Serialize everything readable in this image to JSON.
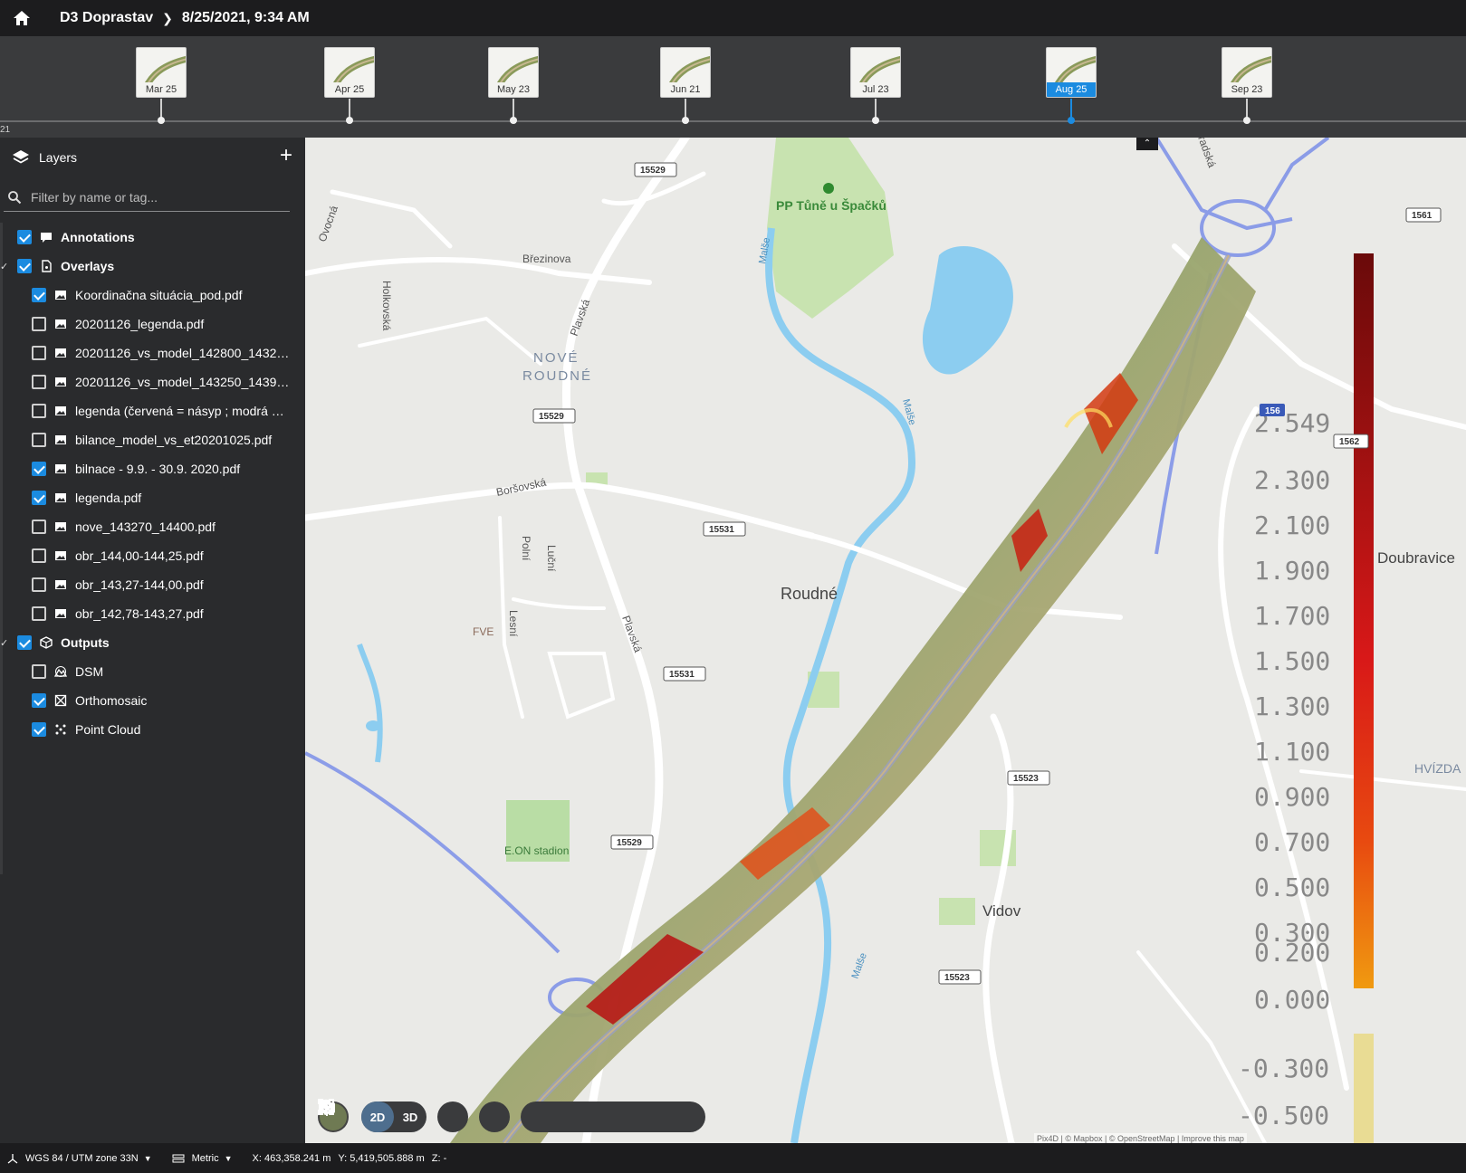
{
  "header": {
    "home_icon": "home-icon",
    "project": "D3 Doprastav",
    "date": "8/25/2021, 9:34 AM"
  },
  "timeline": {
    "year_label": "21",
    "items": [
      {
        "label": "Mar 25",
        "active": false
      },
      {
        "label": "Apr 25",
        "active": false
      },
      {
        "label": "May 23",
        "active": false
      },
      {
        "label": "Jun 21",
        "active": false
      },
      {
        "label": "Jul 23",
        "active": false
      },
      {
        "label": "Aug 25",
        "active": true
      },
      {
        "label": "Sep 23",
        "active": false
      }
    ]
  },
  "sidebar": {
    "title": "Layers",
    "add_icon": "plus-icon",
    "search_placeholder": "Filter by name or tag...",
    "annotations": {
      "label": "Annotations",
      "checked": true
    },
    "overlays": {
      "label": "Overlays",
      "checked": true,
      "items": [
        {
          "label": "Koordinačna situácia_pod.pdf",
          "checked": true
        },
        {
          "label": "20201126_legenda.pdf",
          "checked": false
        },
        {
          "label": "20201126_vs_model_142800_143200.pdf",
          "checked": false
        },
        {
          "label": "20201126_vs_model_143250_143950.pdf",
          "checked": false
        },
        {
          "label": "legenda (červená = násyp ; modrá = výkop).pdf",
          "checked": false
        },
        {
          "label": "bilance_model_vs_et20201025.pdf",
          "checked": false
        },
        {
          "label": "bilnace - 9.9. - 30.9. 2020.pdf",
          "checked": true
        },
        {
          "label": "legenda.pdf",
          "checked": true
        },
        {
          "label": "nove_143270_14400.pdf",
          "checked": false
        },
        {
          "label": "obr_144,00-144,25.pdf",
          "checked": false
        },
        {
          "label": "obr_143,27-144,00.pdf",
          "checked": false
        },
        {
          "label": "obr_142,78-143,27.pdf",
          "checked": false
        }
      ]
    },
    "outputs": {
      "label": "Outputs",
      "checked": true,
      "items": [
        {
          "label": "DSM",
          "checked": false,
          "icon": "dsm-icon"
        },
        {
          "label": "Orthomosaic",
          "checked": true,
          "icon": "orthomosaic-icon"
        },
        {
          "label": "Point Cloud",
          "checked": true,
          "icon": "point-cloud-icon"
        }
      ]
    }
  },
  "map": {
    "labels": {
      "pp_tune": "PP Tůně u Špačků",
      "nove_roudne_1": "NOVÉ",
      "nove_roudne_2": "ROUDNÉ",
      "roudne": "Roudné",
      "vidov": "Vidov",
      "doubravice": "Doubravice",
      "hvizda": "HVÍZDA",
      "eon": "E.ON stadion",
      "fve": "FVE",
      "brezinova": "Březinova",
      "plavska": "Plavská",
      "borsovska": "Boršovská",
      "polni": "Polní",
      "lucni": "Luční",
      "lesni": "Lesní",
      "holkovska": "Holkovská",
      "ovocna": "Ovocná",
      "malse": "Malše",
      "radska": "radská"
    },
    "road_badges": [
      "15529",
      "15529",
      "15531",
      "15531",
      "15529",
      "15523",
      "15523",
      "1561",
      "1562",
      "156"
    ],
    "legend_ticks": [
      "2.549",
      "2.300",
      "2.100",
      "1.900",
      "1.700",
      "1.500",
      "1.300",
      "1.100",
      "0.900",
      "0.700",
      "0.500",
      "0.300",
      "0.200",
      "0.000",
      "-0.300",
      "-0.500"
    ],
    "attribution": "Pix4D | © Mapbox | © OpenStreetMap | Improve this map"
  },
  "toolbar": {
    "btn_2d": "2D",
    "btn_3d": "3D",
    "icons": [
      "north-arrow-icon",
      "settings-icon",
      "bookmark-icon",
      "camera-icon",
      "locate-icon",
      "fit-view-icon",
      "zoom-in-icon",
      "zoom-out-icon"
    ]
  },
  "status": {
    "crs": "WGS 84 / UTM zone 33N",
    "units": "Metric",
    "x": "X: 463,358.241 m",
    "y": "Y: 5,419,505.888 m",
    "z": "Z: -"
  },
  "colors": {
    "accent": "#1b8be0",
    "topbar": "#1c1c1e",
    "sidebar": "#2a2b2d",
    "water": "#8ccdf0",
    "park": "#c8e3b0"
  }
}
